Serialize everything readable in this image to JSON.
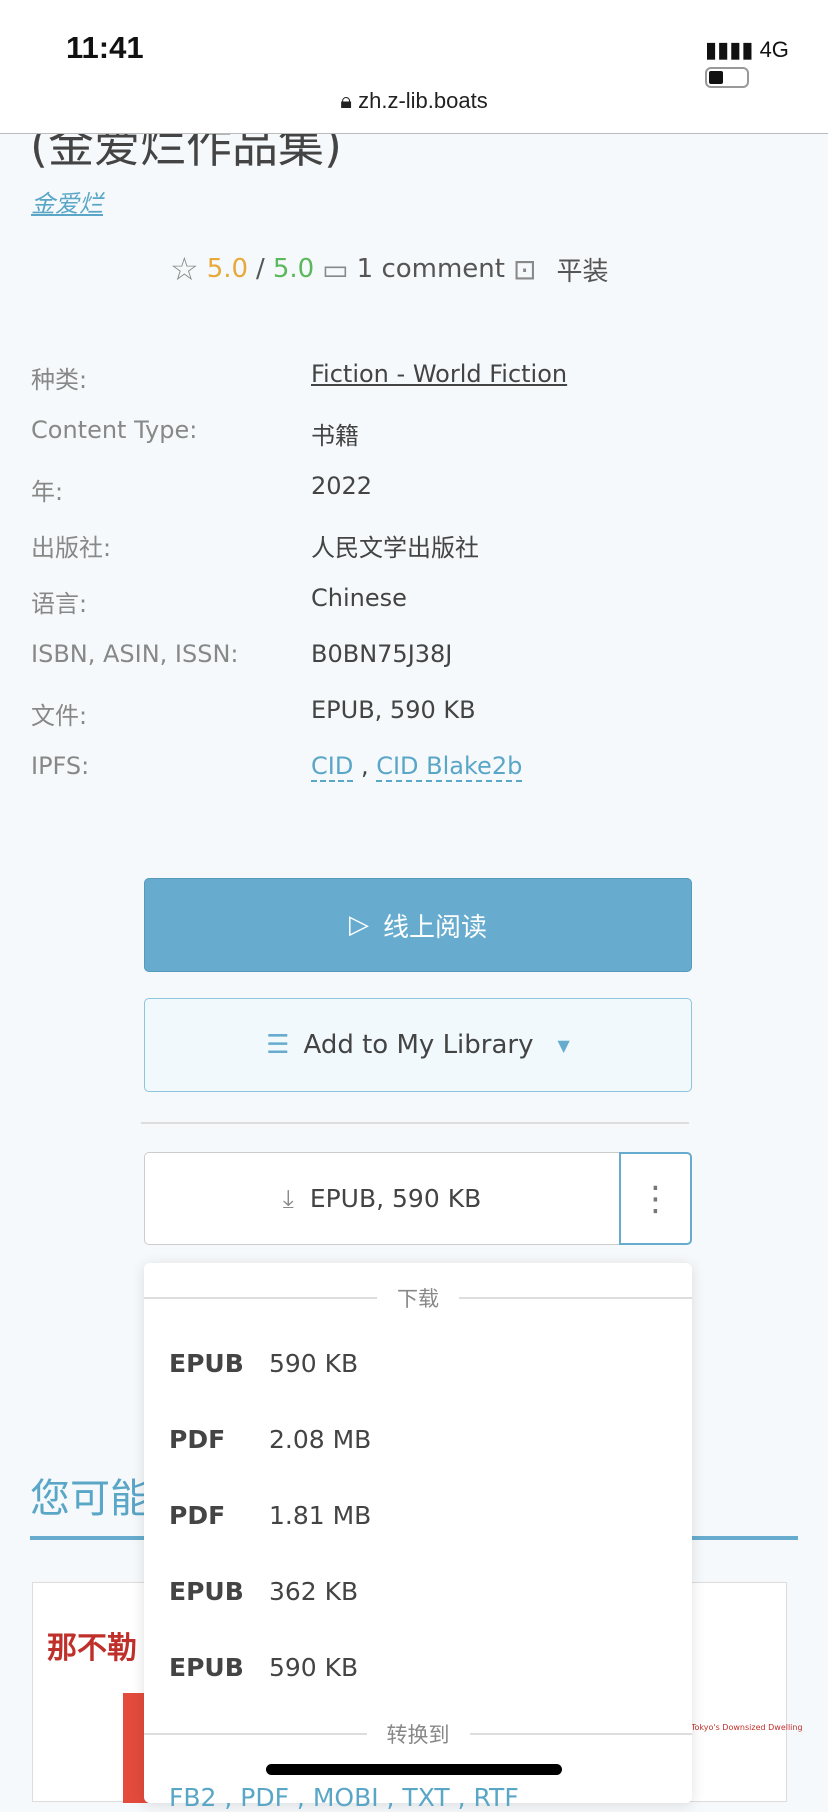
{
  "status": {
    "time": "11:41",
    "network": "4G",
    "url": "zh.z-lib.boats"
  },
  "book": {
    "title": "(金爱烂作品集)",
    "author": "金爱烂",
    "rating": "5.0",
    "rating_max": "5.0",
    "comments": "1 comment",
    "binding": "平装"
  },
  "details": [
    {
      "k": "种类:",
      "v": "Fiction - World Fiction"
    },
    {
      "k": "Content Type:",
      "v": "书籍"
    },
    {
      "k": "年:",
      "v": "2022"
    },
    {
      "k": "出版社:",
      "v": "人民文学出版社"
    },
    {
      "k": "语言:",
      "v": "Chinese"
    },
    {
      "k": "ISBN, ASIN, ISSN:",
      "v": "B0BN75J38J"
    },
    {
      "k": "文件:",
      "v": "EPUB, 590 KB"
    },
    {
      "k": "IPFS:",
      "v": "CID",
      "v2": "CID Blake2b"
    }
  ],
  "buttons": {
    "read": "线上阅读",
    "library": "Add to My Library",
    "download": "EPUB, 590 KB"
  },
  "suggest_heading": "您可能",
  "menu": {
    "download_header": "下载",
    "items": [
      {
        "fmt": "EPUB",
        "size": "590 KB"
      },
      {
        "fmt": "PDF",
        "size": "2.08 MB"
      },
      {
        "fmt": "PDF",
        "size": "1.81 MB"
      },
      {
        "fmt": "EPUB",
        "size": "362 KB"
      },
      {
        "fmt": "EPUB",
        "size": "590 KB"
      }
    ],
    "convert_header": "转换到",
    "convert_formats": "FB2 , PDF , MOBI , TXT , RTF"
  },
  "cards": {
    "left_title": "那不勒",
    "right_caption": "Tokyo's Downsized Dwelling"
  },
  "colors": {
    "accent": "#67acce",
    "rating": "#e8a83a",
    "rating_max": "#5cb85c"
  }
}
